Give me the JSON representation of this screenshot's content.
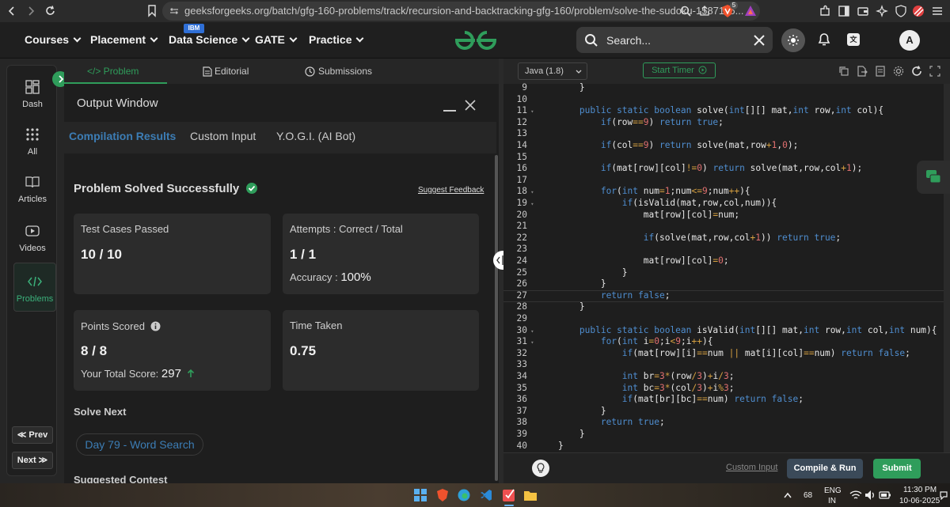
{
  "browser": {
    "url": "geeksforgeeks.org/batch/gfg-160-problems/track/recursion-and-backtracking-gfg-160/problem/solve-the-sudoku-1587115...",
    "shield_count": "5"
  },
  "navbar": {
    "items": [
      "Courses",
      "Placement",
      "Data Science",
      "GATE",
      "Practice"
    ],
    "ibm_badge": "IBM",
    "logo": "GfG",
    "search_placeholder": "Search...",
    "avatar_letter": "A"
  },
  "sidebar": {
    "items": [
      {
        "label": "Dash",
        "icon": "dashboard-icon"
      },
      {
        "label": "All",
        "icon": "grid-icon"
      },
      {
        "label": "Articles",
        "icon": "book-icon"
      },
      {
        "label": "Videos",
        "icon": "play-icon"
      },
      {
        "label": "Problems",
        "icon": "code-icon"
      }
    ],
    "prev_label": "≪ Prev",
    "next_label": "Next ≫"
  },
  "problem_tabs": [
    "</> Problem",
    "Editorial",
    "Submissions"
  ],
  "output": {
    "title": "Output Window",
    "tabs": [
      "Compilation Results",
      "Custom Input",
      "Y.O.G.I. (AI Bot)"
    ],
    "status": "Problem Solved Successfully",
    "feedback_link": "Suggest Feedback",
    "cards": {
      "test_cases_label": "Test Cases Passed",
      "test_cases_value": "10 / 10",
      "attempts_label": "Attempts : Correct / Total",
      "attempts_value": "1 / 1",
      "accuracy_label": "Accuracy :",
      "accuracy_value": "100%",
      "points_label": "Points Scored",
      "points_value": "8 / 8",
      "total_score_label": "Your Total Score:",
      "total_score_value": "297",
      "time_label": "Time Taken",
      "time_value": "0.75"
    },
    "solve_next_label": "Solve Next",
    "next_problem": "Day 79 - Word Search",
    "suggested_label": "Suggested Contest"
  },
  "editor": {
    "language": "Java (1.8)",
    "timer_label": "Start Timer",
    "custom_input": "Custom Input",
    "compile_label": "Compile & Run",
    "submit_label": "Submit",
    "code": [
      {
        "n": "9",
        "t": "        }"
      },
      {
        "n": "10",
        "t": ""
      },
      {
        "n": "11",
        "t": "        public static boolean solve(int[][] mat,int row,int col){",
        "fold": true
      },
      {
        "n": "12",
        "t": "            if(row==9) return true;"
      },
      {
        "n": "13",
        "t": ""
      },
      {
        "n": "14",
        "t": "            if(col==9) return solve(mat,row+1,0);"
      },
      {
        "n": "15",
        "t": ""
      },
      {
        "n": "16",
        "t": "            if(mat[row][col]!=0) return solve(mat,row,col+1);"
      },
      {
        "n": "17",
        "t": ""
      },
      {
        "n": "18",
        "t": "            for(int num=1;num<=9;num++){",
        "fold": true
      },
      {
        "n": "19",
        "t": "                if(isValid(mat,row,col,num)){",
        "fold": true
      },
      {
        "n": "20",
        "t": "                    mat[row][col]=num;"
      },
      {
        "n": "21",
        "t": ""
      },
      {
        "n": "22",
        "t": "                    if(solve(mat,row,col+1)) return true;"
      },
      {
        "n": "23",
        "t": ""
      },
      {
        "n": "24",
        "t": "                    mat[row][col]=0;"
      },
      {
        "n": "25",
        "t": "                }"
      },
      {
        "n": "26",
        "t": "            }"
      },
      {
        "n": "27",
        "t": "            return false;"
      },
      {
        "n": "28",
        "t": "        }"
      },
      {
        "n": "29",
        "t": ""
      },
      {
        "n": "30",
        "t": "        public static boolean isValid(int[][] mat,int row,int col,int num){",
        "fold": true
      },
      {
        "n": "31",
        "t": "            for(int i=0;i<9;i++){",
        "fold": true
      },
      {
        "n": "32",
        "t": "                if(mat[row][i]==num || mat[i][col]==num) return false;"
      },
      {
        "n": "33",
        "t": ""
      },
      {
        "n": "34",
        "t": "                int br=3*(row/3)+i/3;"
      },
      {
        "n": "35",
        "t": "                int bc=3*(col/3)+i%3;"
      },
      {
        "n": "36",
        "t": "                if(mat[br][bc]==num) return false;"
      },
      {
        "n": "37",
        "t": "            }"
      },
      {
        "n": "38",
        "t": "            return true;"
      },
      {
        "n": "39",
        "t": "        }"
      },
      {
        "n": "40",
        "t": "    }"
      }
    ]
  },
  "taskbar": {
    "temperature": "68",
    "lang_line1": "ENG",
    "lang_line2": "IN",
    "time": "11:30 PM",
    "date": "10-06-2025"
  },
  "colors": {
    "accent_green": "#2f9d5b",
    "link_blue": "#3c7db5",
    "keyword_blue": "#4f8ed0",
    "number_red": "#e07070"
  }
}
